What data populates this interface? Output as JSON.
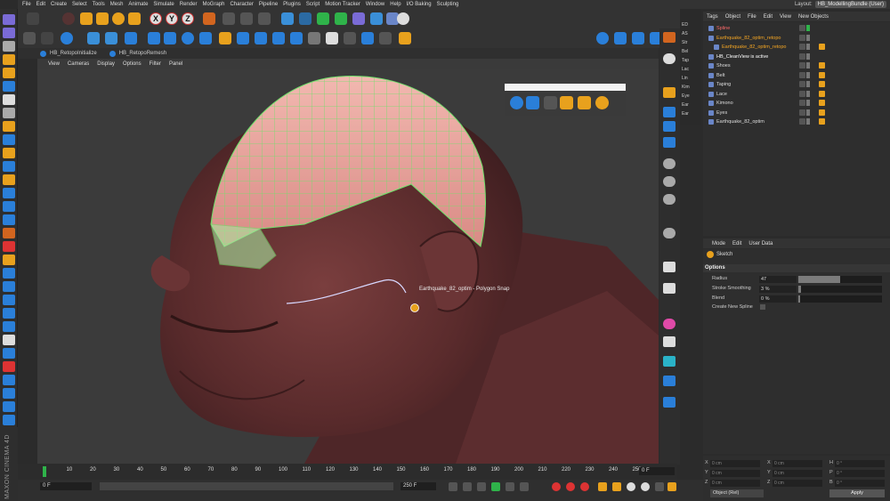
{
  "menubar": [
    "File",
    "Edit",
    "Create",
    "Select",
    "Tools",
    "Mesh",
    "Animate",
    "Simulate",
    "Render",
    "MoGraph",
    "Character",
    "Pipeline",
    "Plugins",
    "Script",
    "Motion Tracker",
    "Window",
    "Help",
    "I/O Baking",
    "Sculpting"
  ],
  "layout": {
    "label": "Layout:",
    "value": "HB_ModellingBundle (User)"
  },
  "script_bar": [
    {
      "label": "HB_RetopoInitialize"
    },
    {
      "label": "HB_RetopoRemesh"
    }
  ],
  "viewport_menu": [
    "View",
    "Cameras",
    "Display",
    "Options",
    "Filter",
    "Panel"
  ],
  "viewport": {
    "snap_tooltip": "Earthquake_82_optim - Polygon Snap"
  },
  "tag_strip": [
    "ED",
    "AS",
    "Str",
    "Bel",
    "Tap",
    "Lac",
    "Lin",
    "Kim",
    "Eye",
    "Ear",
    "Ear"
  ],
  "object_manager": {
    "menu": [
      "Tags",
      "Object",
      "File",
      "Edit",
      "View",
      "New Objects"
    ],
    "objects": [
      {
        "name": "Spline",
        "color": "#ff6a6a",
        "indent": 0
      },
      {
        "name": "Earthquake_82_optim_retopo",
        "color": "#f5a623",
        "indent": 0
      },
      {
        "name": "Earthquake_82_optim_retopo",
        "color": "#f5a623",
        "indent": 1
      },
      {
        "name": "HB_CleanView is active",
        "color": "#ffffff",
        "indent": 0
      },
      {
        "name": "Shoes",
        "color": "#dddddd",
        "indent": 0
      },
      {
        "name": "Belt",
        "color": "#dddddd",
        "indent": 0
      },
      {
        "name": "Taping",
        "color": "#dddddd",
        "indent": 0
      },
      {
        "name": "Lace",
        "color": "#dddddd",
        "indent": 0
      },
      {
        "name": "Kimono",
        "color": "#dddddd",
        "indent": 0
      },
      {
        "name": "Eyes",
        "color": "#dddddd",
        "indent": 0
      },
      {
        "name": "Earthquake_82_optim",
        "color": "#dddddd",
        "indent": 0
      }
    ]
  },
  "attributes": {
    "menu": [
      "Mode",
      "Edit",
      "User Data"
    ],
    "tool_name": "Sketch",
    "section": "Options",
    "fields": [
      {
        "label": "Radius",
        "value": "47",
        "fill": 0.5
      },
      {
        "label": "Stroke Smoothing",
        "value": "3 %",
        "fill": 0.03
      },
      {
        "label": "Blend",
        "value": "0 %",
        "fill": 0.0
      }
    ],
    "checkbox_label": "Create New Spline"
  },
  "coordinates": {
    "rows": [
      {
        "a": "X",
        "av": "0 cm",
        "b": "X",
        "bv": "0 cm",
        "c": "H",
        "cv": "0 °"
      },
      {
        "a": "Y",
        "av": "0 cm",
        "b": "Y",
        "bv": "0 cm",
        "c": "P",
        "cv": "0 °"
      },
      {
        "a": "Z",
        "av": "0 cm",
        "b": "Z",
        "bv": "0 cm",
        "c": "B",
        "cv": "0 °"
      }
    ],
    "mode": "Object (Rel)",
    "apply": "Apply"
  },
  "timeline": {
    "ticks": [
      "0",
      "10",
      "20",
      "30",
      "40",
      "50",
      "60",
      "70",
      "80",
      "90",
      "100",
      "110",
      "120",
      "130",
      "140",
      "150",
      "160",
      "170",
      "180",
      "190",
      "200",
      "210",
      "220",
      "230",
      "240",
      "250"
    ],
    "current": "0 F"
  },
  "transport": {
    "start": "0 F",
    "end": "250 F"
  },
  "brand": "MAXON CINEMA 4D"
}
